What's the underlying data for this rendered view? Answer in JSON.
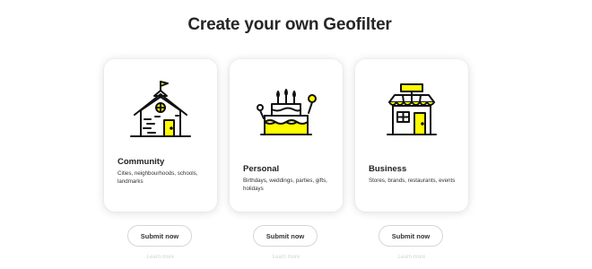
{
  "page": {
    "title": "Create your own Geofilter"
  },
  "cards": [
    {
      "icon": "schoolhouse-icon",
      "title": "Community",
      "description": "Cities, neighbourhoods, schools, landmarks",
      "button_label": "Submit now",
      "link_label": "Learn more"
    },
    {
      "icon": "birthday-cake-icon",
      "title": "Personal",
      "description": "Birthdays, weddings, parties, gifts, holidays",
      "button_label": "Submit now",
      "link_label": "Learn more"
    },
    {
      "icon": "storefront-icon",
      "title": "Business",
      "description": "Stores, brands, restaurants, events",
      "button_label": "Submit now",
      "link_label": "Learn more"
    }
  ],
  "colors": {
    "accent_yellow": "#FFFC00",
    "outline": "#111111",
    "muted_link": "#D3D3D3"
  }
}
